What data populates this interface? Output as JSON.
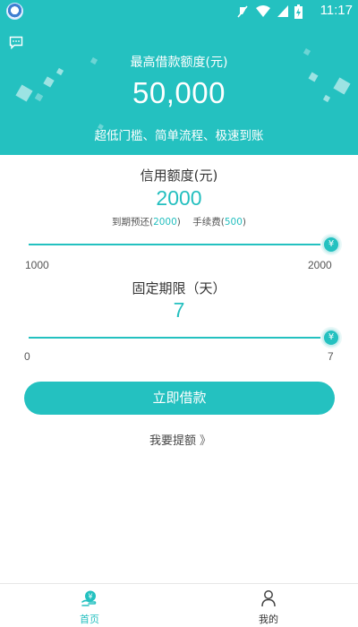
{
  "status_bar": {
    "time": "11:17"
  },
  "hero": {
    "label": "最高借款额度(元)",
    "amount": "50,000",
    "slogan": "超低门槛、简单流程、极速到账"
  },
  "credit": {
    "title": "信用额度(元)",
    "value": "2000",
    "repay_label": "到期预还(",
    "repay_value": "2000",
    "repay_close": ")",
    "fee_label": "手续费(",
    "fee_value": "500",
    "fee_close": ")",
    "min": "1000",
    "max": "2000",
    "thumb_symbol": "¥",
    "slider_fraction": 1.0
  },
  "term": {
    "title": "固定期限（天）",
    "value": "7",
    "min": "0",
    "max": "7",
    "thumb_symbol": "¥",
    "slider_fraction": 1.0
  },
  "actions": {
    "borrow_label": "立即借款",
    "raise_label": "我要提额",
    "raise_chevron": "》"
  },
  "nav": {
    "items": [
      {
        "label": "首页",
        "icon": "home-hand-yen-icon",
        "active": true
      },
      {
        "label": "我的",
        "icon": "person-icon",
        "active": false
      }
    ]
  },
  "colors": {
    "accent": "#24c1c0",
    "text": "#333333"
  }
}
